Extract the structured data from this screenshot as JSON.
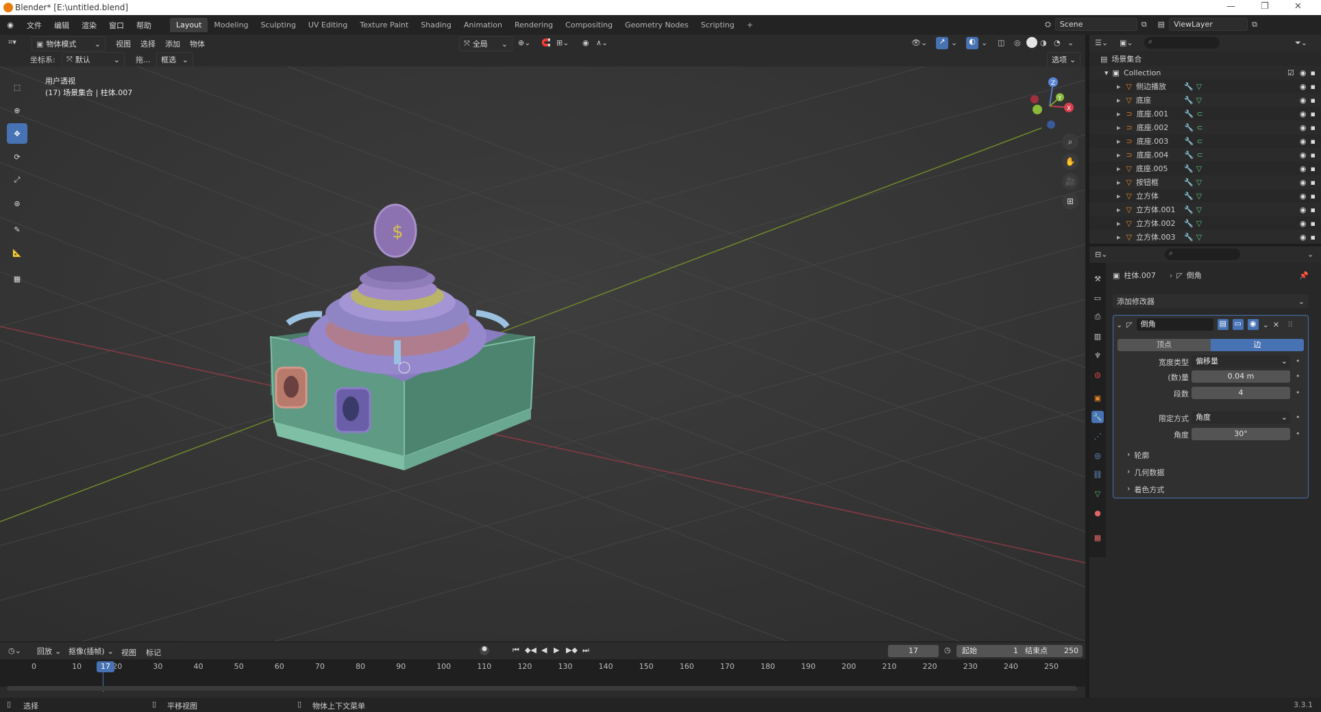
{
  "window": {
    "title": "Blender* [E:\\untitled.blend]"
  },
  "topbar": {
    "menus": [
      "文件",
      "编辑",
      "渲染",
      "窗口",
      "帮助"
    ],
    "workspaces": [
      "Layout",
      "Modeling",
      "Sculpting",
      "UV Editing",
      "Texture Paint",
      "Shading",
      "Animation",
      "Rendering",
      "Compositing",
      "Geometry Nodes",
      "Scripting"
    ],
    "add_tab": "+",
    "scene": "Scene",
    "view_layer": "ViewLayer"
  },
  "viewport_header": {
    "mode": "物体模式",
    "menus": [
      "视图",
      "选择",
      "添加",
      "物体"
    ],
    "transform_orientation": "全局",
    "coord_label": "坐标系:",
    "coord_value": "默认",
    "drag_label": "拖...",
    "drag_value": "框选",
    "options": "选项"
  },
  "viewport": {
    "view_name": "用户透视",
    "collection_info": "(17) 场景集合 | 柱体.007",
    "gizmo_axes": [
      "X",
      "Y",
      "Z"
    ],
    "colors": {
      "bg": "#3a3a3a",
      "grid": "#444444",
      "x_axis": "#8a3a44",
      "y_axis": "#6f8a2a"
    }
  },
  "outliner": {
    "root": "场景集合",
    "collection": "Collection",
    "items": [
      {
        "name": "侧边播放",
        "type": "mesh"
      },
      {
        "name": "底座",
        "type": "mesh"
      },
      {
        "name": "底座.001",
        "type": "curve"
      },
      {
        "name": "底座.002",
        "type": "curve"
      },
      {
        "name": "底座.003",
        "type": "curve"
      },
      {
        "name": "底座.004",
        "type": "curve"
      },
      {
        "name": "底座.005",
        "type": "mesh"
      },
      {
        "name": "按钮框",
        "type": "mesh"
      },
      {
        "name": "立方体",
        "type": "mesh"
      },
      {
        "name": "立方体.001",
        "type": "mesh"
      },
      {
        "name": "立方体.002",
        "type": "mesh"
      },
      {
        "name": "立方体.003",
        "type": "mesh"
      }
    ]
  },
  "properties": {
    "object_name": "柱体.007",
    "modifier_breadcrumb": "倒角",
    "add_modifier": "添加修改器",
    "modifier_name": "倒角",
    "affect_vertices": "顶点",
    "affect_edges": "边",
    "width_type_label": "宽度类型",
    "width_type_value": "偏移量",
    "amount_label": "(数)量",
    "amount_value": "0.04 m",
    "segments_label": "段数",
    "segments_value": "4",
    "limit_method_label": "限定方式",
    "limit_method_value": "角度",
    "angle_label": "角度",
    "angle_value": "30°",
    "subpanels": [
      "轮廓",
      "几何数据",
      "着色方式"
    ]
  },
  "timeline": {
    "menus": [
      "回放",
      "抠像(插帧)",
      "视图",
      "标记"
    ],
    "current_frame": "17",
    "start_label": "起始",
    "start_value": "1",
    "end_label": "结束点",
    "end_value": "250",
    "playhead_label": "17",
    "ticks": [
      "0",
      "10",
      "20",
      "30",
      "40",
      "50",
      "60",
      "70",
      "80",
      "90",
      "100",
      "110",
      "120",
      "130",
      "140",
      "150",
      "160",
      "170",
      "180",
      "190",
      "200",
      "210",
      "220",
      "230",
      "240",
      "250"
    ]
  },
  "statusbar": {
    "select": "选择",
    "pan": "平移视图",
    "context": "物体上下文菜单",
    "version": "3.3.1"
  }
}
